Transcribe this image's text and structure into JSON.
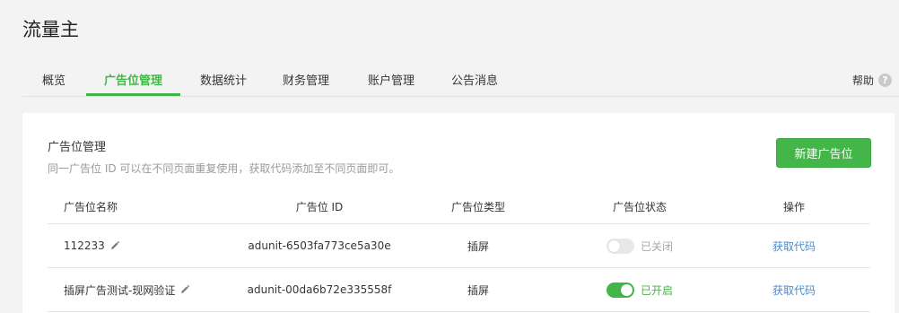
{
  "page": {
    "title": "流量主"
  },
  "nav": {
    "tabs": [
      {
        "label": "概览"
      },
      {
        "label": "广告位管理"
      },
      {
        "label": "数据统计"
      },
      {
        "label": "财务管理"
      },
      {
        "label": "账户管理"
      },
      {
        "label": "公告消息"
      }
    ],
    "active_index": 1,
    "help_label": "帮助",
    "help_icon_glyph": "?"
  },
  "card": {
    "title": "广告位管理",
    "description": "同一广告位 ID 可以在不同页面重复使用，获取代码添加至不同页面即可。",
    "new_button_label": "新建广告位"
  },
  "table": {
    "columns": [
      "广告位名称",
      "广告位 ID",
      "广告位类型",
      "广告位状态",
      "操作"
    ],
    "rows": [
      {
        "name": "112233",
        "id": "adunit-6503fa773ce5a30e",
        "type": "插屏",
        "enabled": false,
        "status_label": "已关闭",
        "action": "获取代码"
      },
      {
        "name": "插屏广告测试-现网验证",
        "id": "adunit-00da6b72e335558f",
        "type": "插屏",
        "enabled": true,
        "status_label": "已开启",
        "action": "获取代码"
      }
    ]
  },
  "colors": {
    "accent": "#44b549",
    "link": "#4a8bc9",
    "background": "#f3f3f3"
  }
}
